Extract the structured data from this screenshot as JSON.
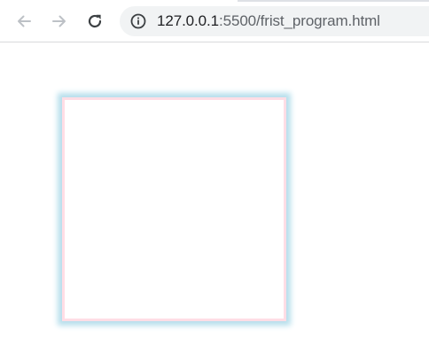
{
  "toolbar": {
    "back_icon": "back-arrow-icon",
    "forward_icon": "forward-arrow-icon",
    "reload_icon": "reload-icon",
    "address_bar": {
      "info_icon": "info-icon",
      "url_host": "127.0.0.1",
      "url_rest": ":5500/frist_program.html"
    }
  },
  "page": {
    "box": {
      "border_color": "#ffdde5",
      "shadow_color": "#b7dfec",
      "fill_color": "#ffffff"
    }
  },
  "colors": {
    "toolbar_bg": "#ffffff",
    "omnibox_bg": "#f1f3f4",
    "icon_disabled": "#bdc1c6",
    "icon_active": "#5f6368",
    "text_primary": "#202124"
  }
}
